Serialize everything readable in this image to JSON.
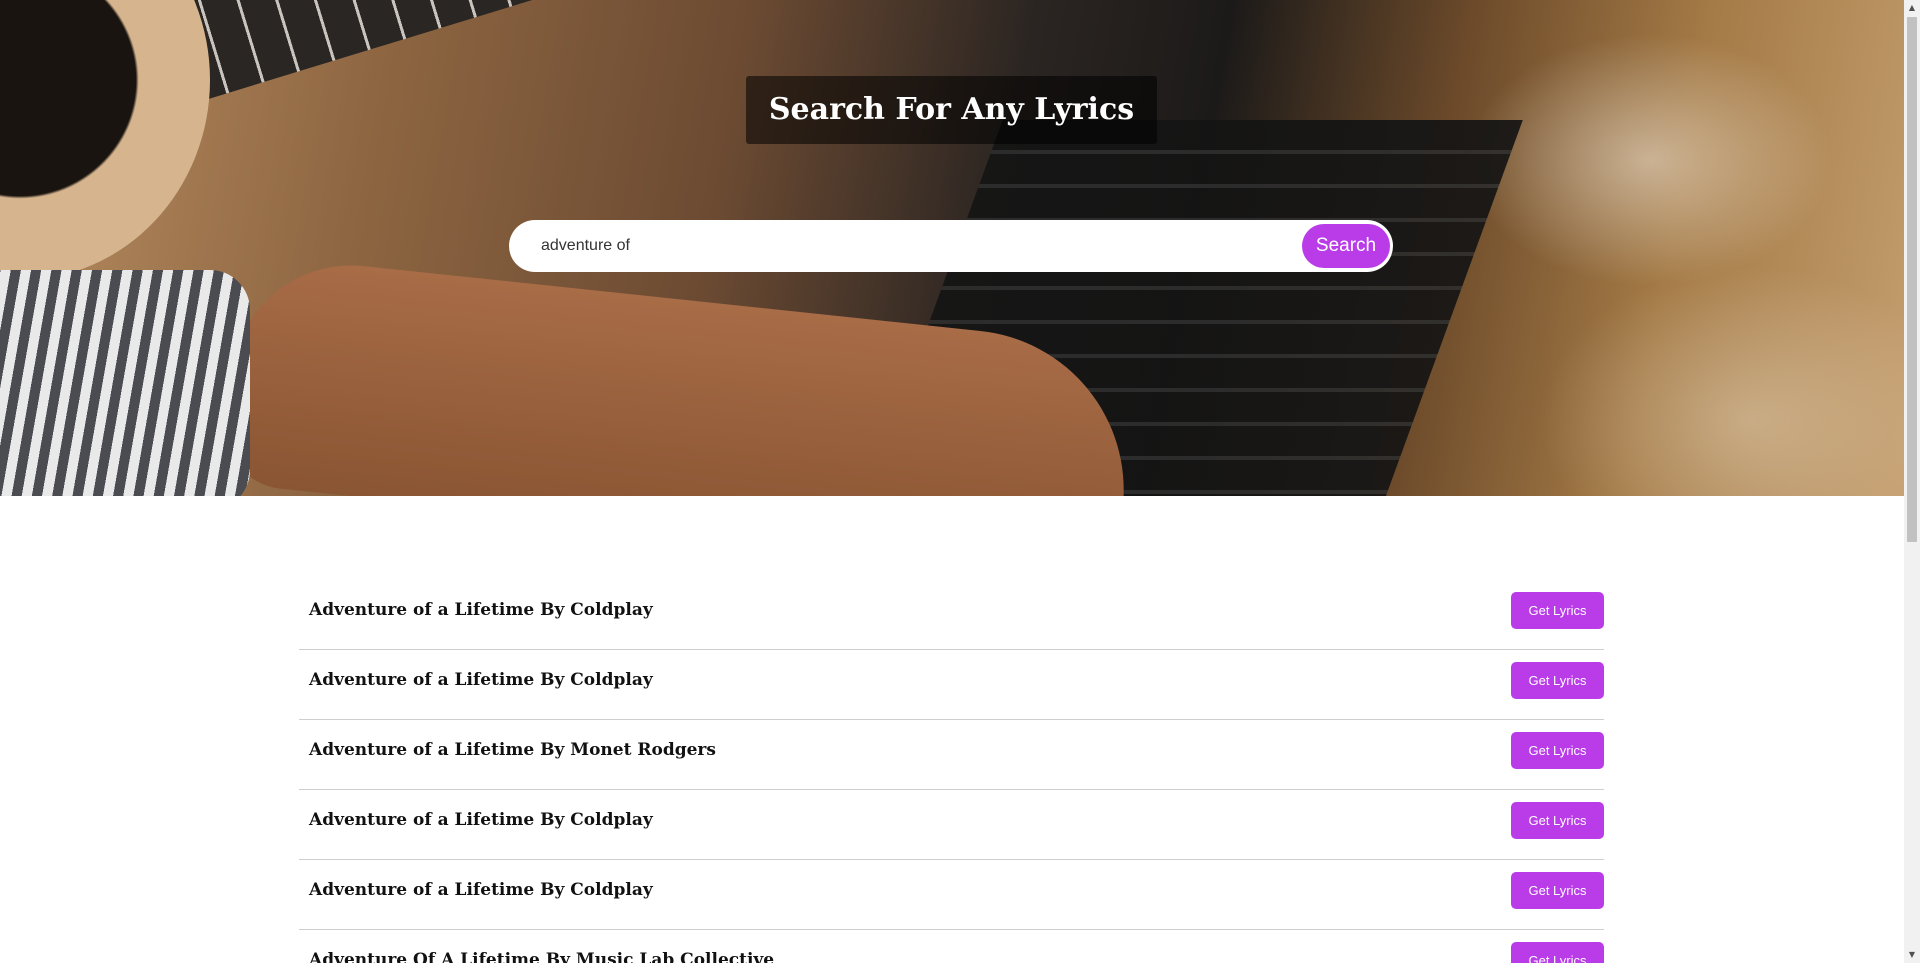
{
  "hero": {
    "title": "Search For Any Lyrics"
  },
  "search": {
    "value": "adventure of",
    "button_label": "Search"
  },
  "results": [
    {
      "title": "Adventure of a Lifetime By Coldplay",
      "button_label": "Get Lyrics"
    },
    {
      "title": "Adventure of a Lifetime By Coldplay",
      "button_label": "Get Lyrics"
    },
    {
      "title": "Adventure of a Lifetime By Monet Rodgers",
      "button_label": "Get Lyrics"
    },
    {
      "title": "Adventure of a Lifetime By Coldplay",
      "button_label": "Get Lyrics"
    },
    {
      "title": "Adventure of a Lifetime By Coldplay",
      "button_label": "Get Lyrics"
    },
    {
      "title": "Adventure Of A Lifetime By Music Lab Collective",
      "button_label": "Get Lyrics"
    }
  ],
  "colors": {
    "accent": "#b93ce8",
    "title_box": "#000000"
  },
  "icons": {
    "scroll_up": "triangle-up-icon",
    "scroll_down": "triangle-down-icon"
  }
}
